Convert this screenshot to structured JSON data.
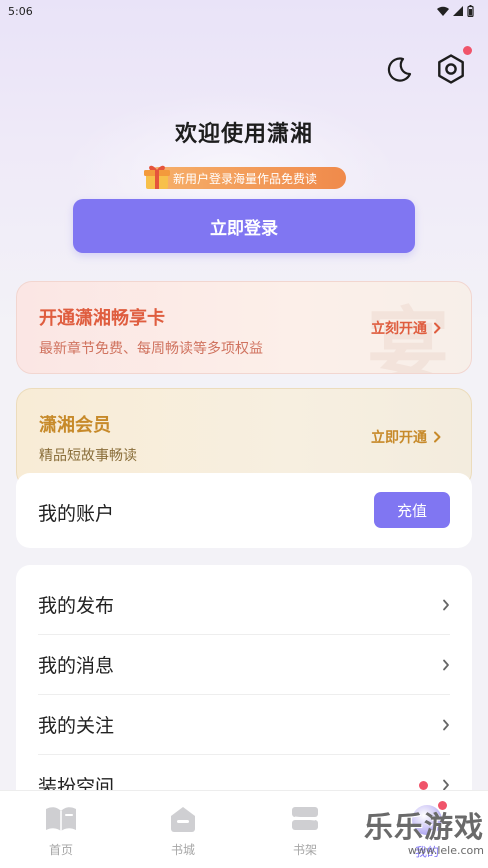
{
  "status_bar": {
    "time": "5:06"
  },
  "header": {
    "welcome_title": "欢迎使用潇湘",
    "promo_text": "新用户登录海量作品免费读",
    "login_label": "立即登录"
  },
  "vip_card": {
    "title": "开通潇湘畅享卡",
    "subtitle": "最新章节免费、每周畅读等多项权益",
    "action": "立刻开通",
    "watermark": "宴"
  },
  "member_card": {
    "title": "潇湘会员",
    "subtitle": "精品短故事畅读",
    "action": "立即开通"
  },
  "account": {
    "label": "我的账户",
    "recharge": "充值"
  },
  "menu": {
    "items": [
      {
        "label": "我的发布"
      },
      {
        "label": "我的消息"
      },
      {
        "label": "我的关注"
      },
      {
        "label": "装扮空间"
      }
    ]
  },
  "tab_bar": {
    "tabs": [
      {
        "label": "首页"
      },
      {
        "label": "书城"
      },
      {
        "label": "书架"
      },
      {
        "label": "我的"
      }
    ]
  },
  "watermark_logo": {
    "text": "乐乐游戏",
    "url": "www.lele.com"
  },
  "colors": {
    "accent": "#8076f2",
    "vip_orange": "#df5d3f",
    "member_gold": "#c78a2a",
    "badge_red": "#f0546a"
  }
}
